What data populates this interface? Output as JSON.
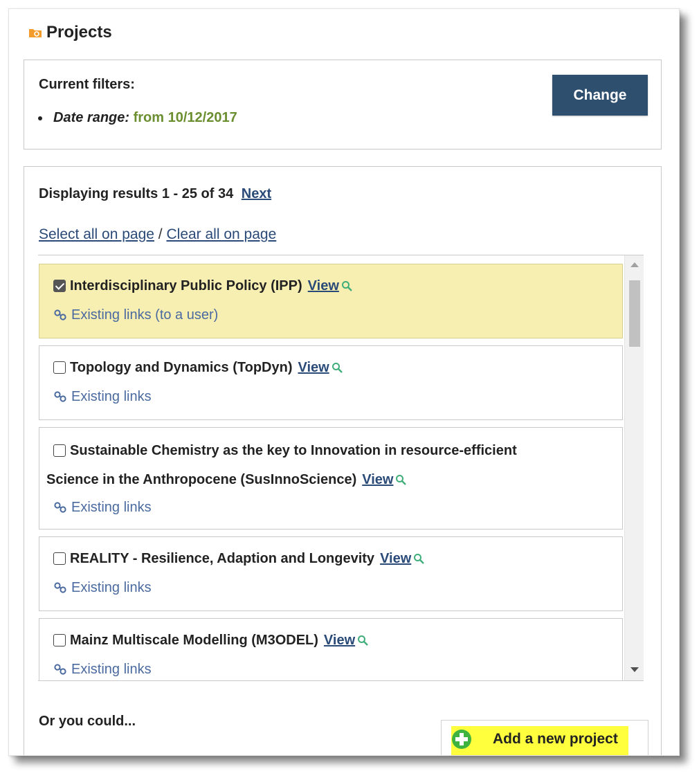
{
  "panel": {
    "title": "Projects"
  },
  "filters": {
    "heading": "Current filters:",
    "date_key": "Date range:",
    "date_value": "from 10/12/2017",
    "change_label": "Change"
  },
  "results": {
    "displaying": "Displaying results 1 - 25 of 34",
    "next_label": "Next",
    "select_all": "Select all on page",
    "separator": " / ",
    "clear_all": "Clear all on page",
    "view_label": "View",
    "items": [
      {
        "title": "Interdisciplinary Public Policy (IPP)",
        "links": "Existing links (to a user)",
        "checked": true
      },
      {
        "title": "Topology and Dynamics (TopDyn)",
        "links": "Existing links",
        "checked": false
      },
      {
        "title_line1": "Sustainable Chemistry as the key to Innovation in resource-efficient",
        "title_line2": "Science in the Anthropocene (SusInnoScience)",
        "links": "Existing links",
        "checked": false
      },
      {
        "title": "REALITY - Resilience, Adaption and Longevity",
        "links": "Existing links",
        "checked": false
      },
      {
        "title": "Mainz Multiscale Modelling (M3ODEL)",
        "links": "Existing links",
        "checked": false
      }
    ]
  },
  "footer": {
    "or_you_could": "Or you could...",
    "add_label": "Add a new project"
  },
  "colors": {
    "change_button": "#2f4f6f",
    "selected_row": "#f7eeb2",
    "link": "#2a4a78",
    "filter_value": "#6b8e2f",
    "add_icon": "#3fb33f",
    "highlight": "#ffff3d"
  },
  "icons": {
    "panel": "folder-icon",
    "view": "magnifier-icon",
    "links": "chain-link-icon",
    "add": "plus-circle-icon"
  }
}
